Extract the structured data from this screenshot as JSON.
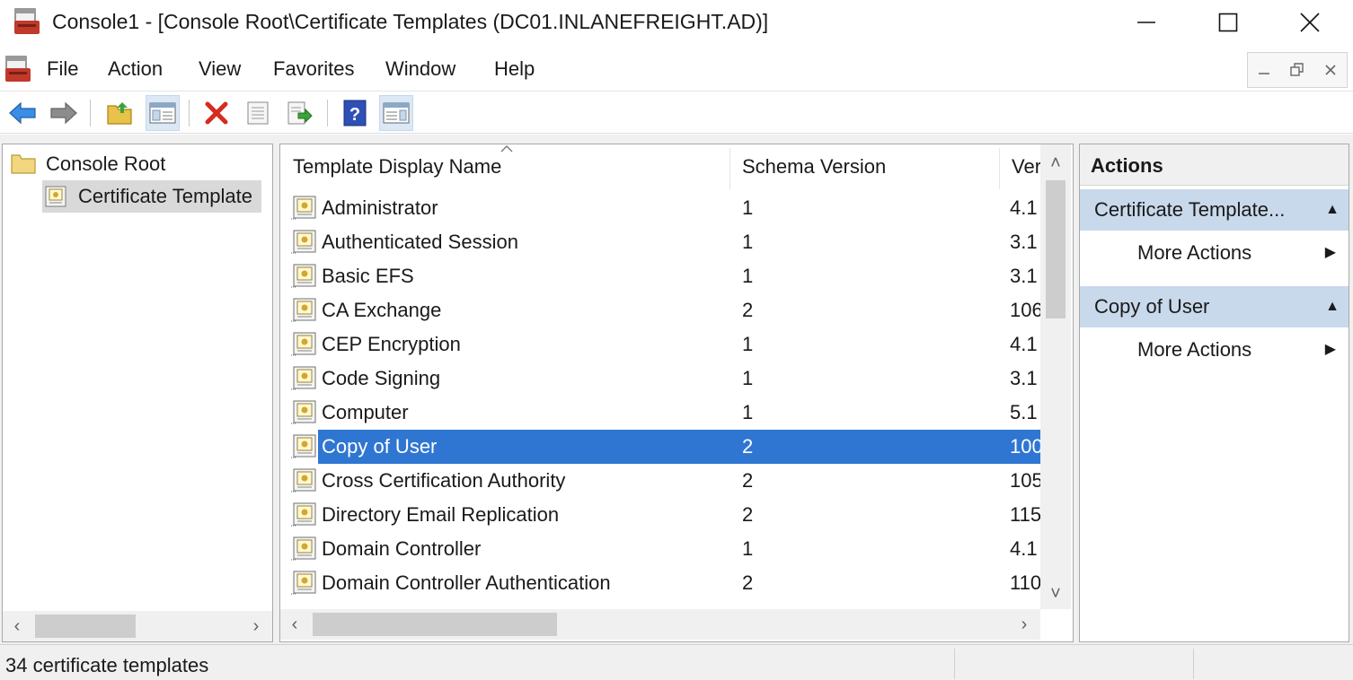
{
  "window": {
    "title": "Console1 - [Console Root\\Certificate Templates (DC01.INLANEFREIGHT.AD)]"
  },
  "menu": {
    "items": [
      "File",
      "Action",
      "View",
      "Favorites",
      "Window",
      "Help"
    ]
  },
  "toolbar": {
    "buttons": [
      "back-arrow-icon",
      "forward-arrow-icon",
      "up-folder-icon",
      "show-hide-tree-icon",
      "delete-icon",
      "properties-icon",
      "export-list-icon",
      "help-icon",
      "show-hide-action-pane-icon"
    ]
  },
  "tree": {
    "root": "Console Root",
    "child": "Certificate Template"
  },
  "list": {
    "columns": [
      "Template Display Name",
      "Schema Version",
      "Ver"
    ],
    "rows": [
      {
        "name": "Administrator",
        "schema": "1",
        "ver": "4.1"
      },
      {
        "name": "Authenticated Session",
        "schema": "1",
        "ver": "3.1"
      },
      {
        "name": "Basic EFS",
        "schema": "1",
        "ver": "3.1"
      },
      {
        "name": "CA Exchange",
        "schema": "2",
        "ver": "106"
      },
      {
        "name": "CEP Encryption",
        "schema": "1",
        "ver": "4.1"
      },
      {
        "name": "Code Signing",
        "schema": "1",
        "ver": "3.1"
      },
      {
        "name": "Computer",
        "schema": "1",
        "ver": "5.1"
      },
      {
        "name": "Copy of User",
        "schema": "2",
        "ver": "100"
      },
      {
        "name": "Cross Certification Authority",
        "schema": "2",
        "ver": "105"
      },
      {
        "name": "Directory Email Replication",
        "schema": "2",
        "ver": "115"
      },
      {
        "name": "Domain Controller",
        "schema": "1",
        "ver": "4.1"
      },
      {
        "name": "Domain Controller Authentication",
        "schema": "2",
        "ver": "110"
      }
    ],
    "selected_index": 7
  },
  "actions": {
    "header": "Actions",
    "group1": "Certificate Template...",
    "group1_item": "More Actions",
    "group2": "Copy of User",
    "group2_item": "More Actions"
  },
  "status": {
    "text": "34 certificate templates"
  },
  "colors": {
    "selection": "#2f76d2",
    "action_group_bg": "#c9d9ec"
  }
}
